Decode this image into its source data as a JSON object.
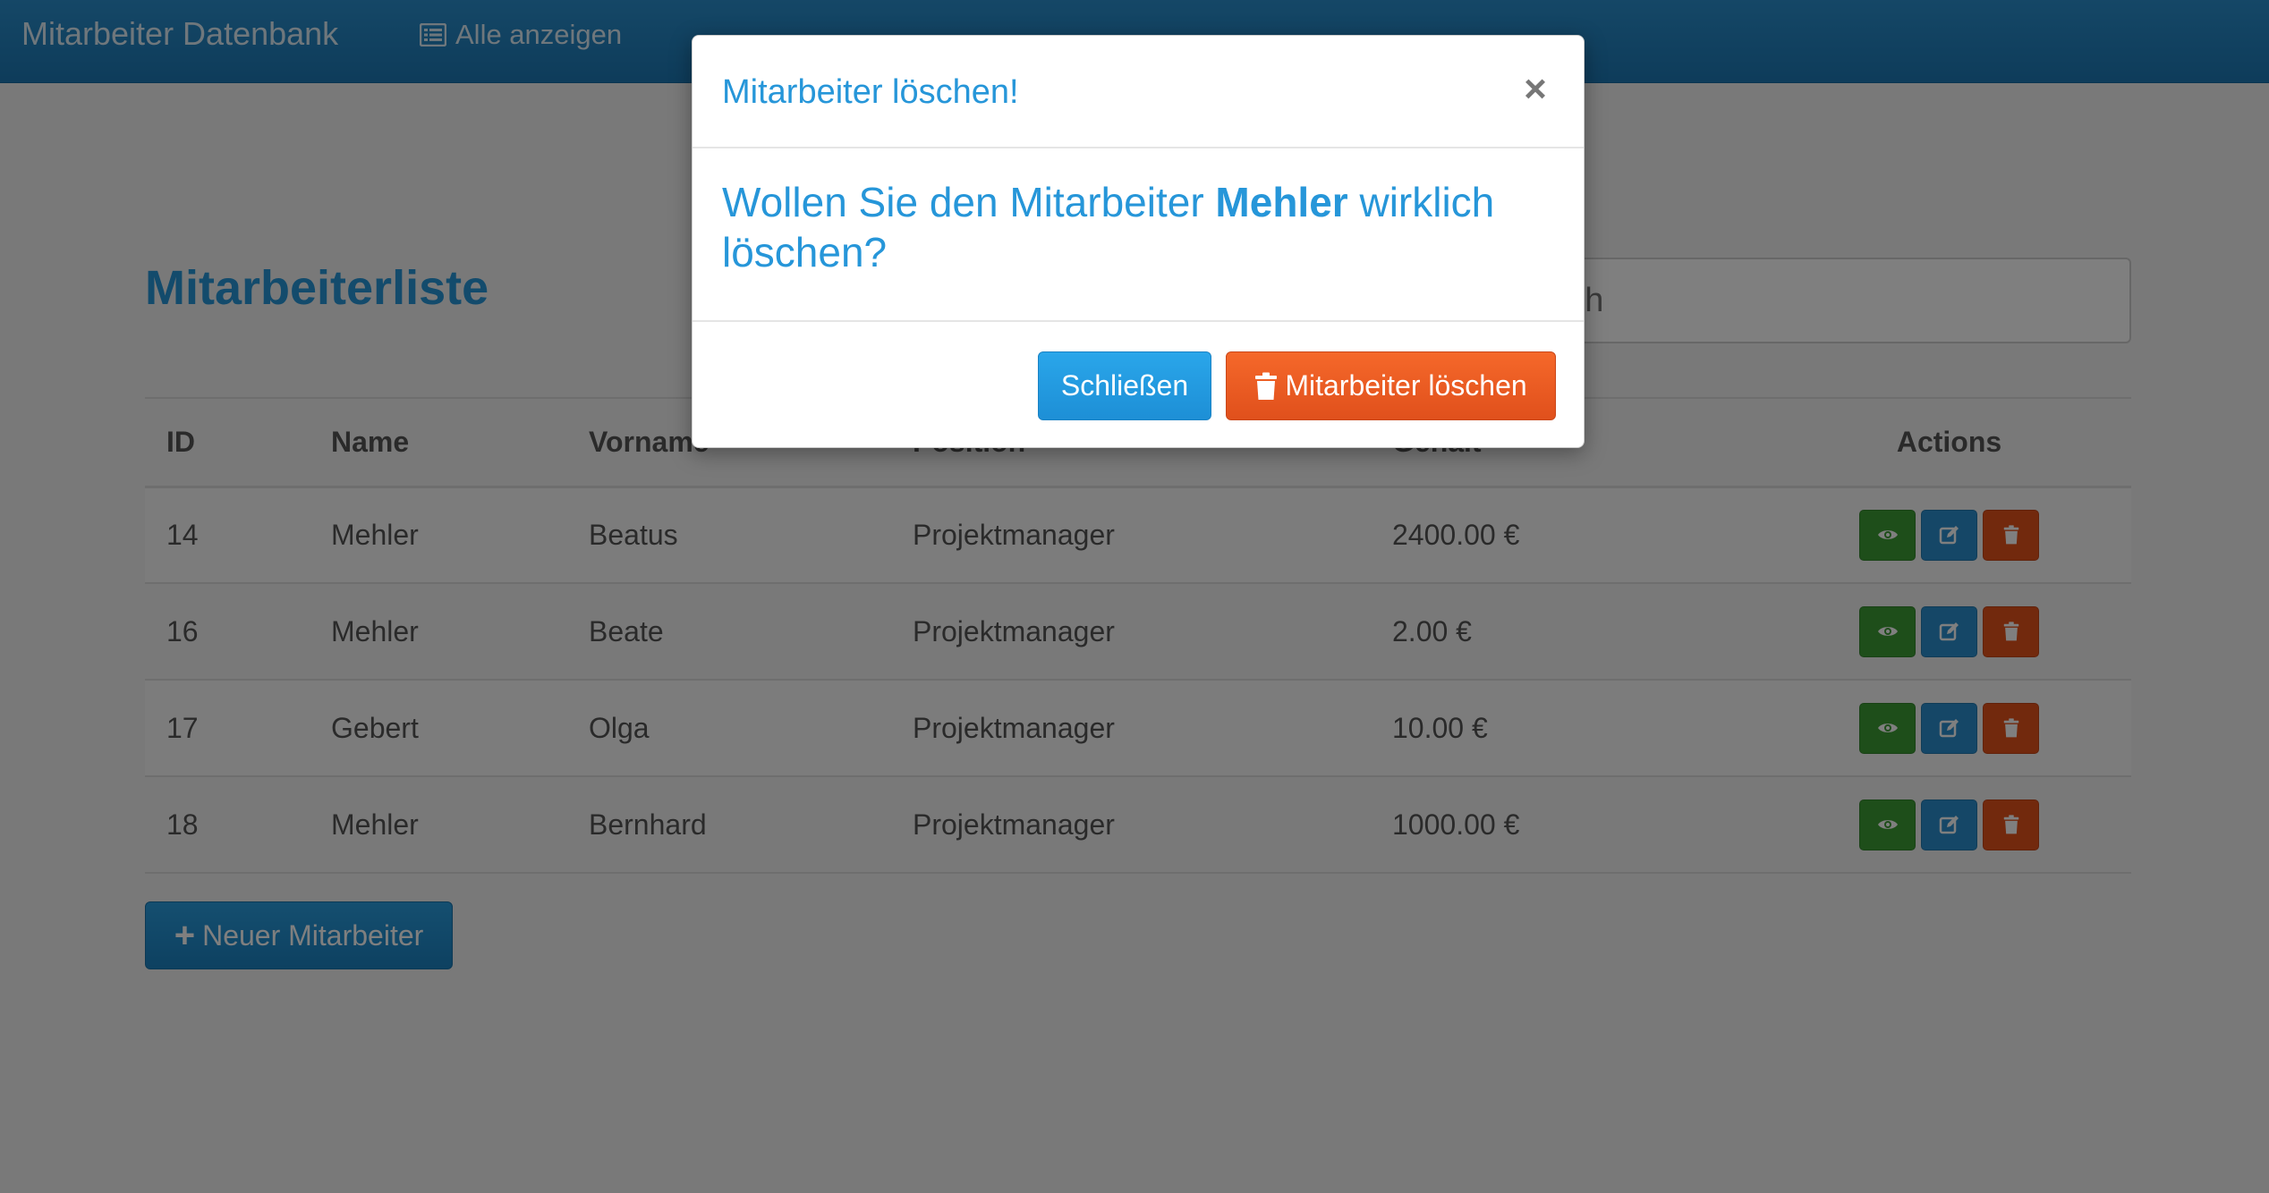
{
  "navbar": {
    "brand": "Mitarbeiter Datenbank",
    "link_label": "Alle anzeigen",
    "link_icon": "list-icon",
    "color": "#1c78b5"
  },
  "page": {
    "title": "Mitarbeiterliste",
    "search_placeholder": "Search"
  },
  "table": {
    "headers": {
      "id": "ID",
      "name": "Name",
      "vorname": "Vorname",
      "position": "Position",
      "gehalt": "Gehalt",
      "actions": "Actions"
    },
    "rows": [
      {
        "id": "14",
        "name": "Mehler",
        "vorname": "Beatus",
        "position": "Projektmanager",
        "gehalt": "2400.00 €"
      },
      {
        "id": "16",
        "name": "Mehler",
        "vorname": "Beate",
        "position": "Projektmanager",
        "gehalt": "2.00 €"
      },
      {
        "id": "17",
        "name": "Gebert",
        "vorname": "Olga",
        "position": "Projektmanager",
        "gehalt": "10.00 €"
      },
      {
        "id": "18",
        "name": "Mehler",
        "vorname": "Bernhard",
        "position": "Projektmanager",
        "gehalt": "1000.00 €"
      }
    ],
    "action_icons": [
      "eye-icon",
      "edit-icon",
      "trash-icon"
    ],
    "action_colors": {
      "view": "#3d9c35",
      "edit": "#2a8fce",
      "delete": "#e4521b"
    }
  },
  "new_button": {
    "label": "Neuer Mitarbeiter",
    "icon": "plus-icon"
  },
  "modal": {
    "title": "Mitarbeiter löschen!",
    "close_symbol": "×",
    "message_before": "Wollen Sie den Mitarbeiter ",
    "employee_name": "Mehler",
    "message_after": " wirklich löschen?",
    "close_label": "Schließen",
    "delete_label": "Mitarbeiter löschen",
    "accent_color": "#2696d9",
    "danger_color": "#e0501c"
  }
}
